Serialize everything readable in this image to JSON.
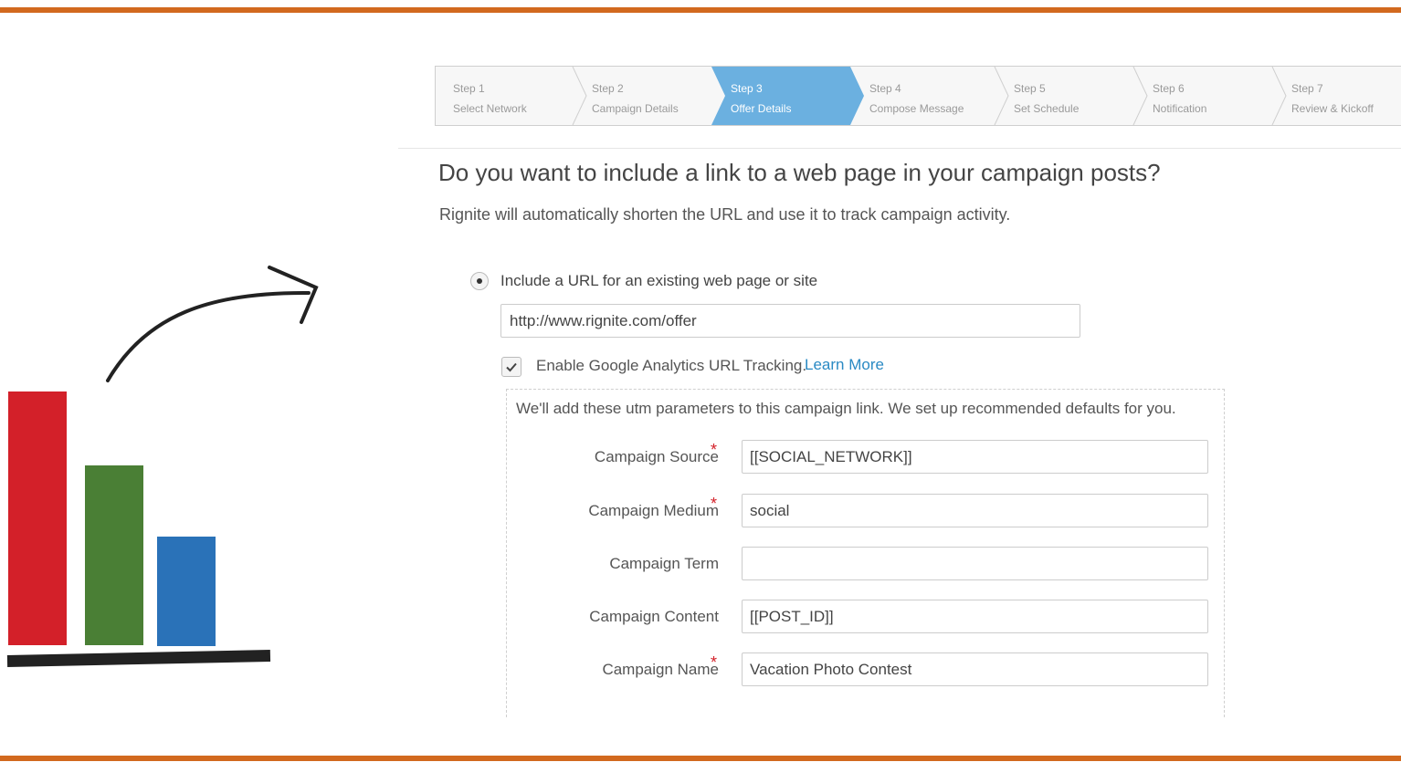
{
  "colors": {
    "accent_rule": "#d2691e",
    "active_step": "#6bb0e0",
    "link": "#2a8ac4",
    "required": "#d32029",
    "bar_red": "#d32029",
    "bar_green": "#4a7f35",
    "bar_blue": "#2a72b8"
  },
  "wizard": {
    "steps": [
      {
        "num": "Step 1",
        "label": "Select Network",
        "active": false
      },
      {
        "num": "Step 2",
        "label": "Campaign Details",
        "active": false
      },
      {
        "num": "Step 3",
        "label": "Offer Details",
        "active": true
      },
      {
        "num": "Step 4",
        "label": "Compose Message",
        "active": false
      },
      {
        "num": "Step 5",
        "label": "Set Schedule",
        "active": false
      },
      {
        "num": "Step 6",
        "label": "Notification",
        "active": false
      },
      {
        "num": "Step 7",
        "label": "Review & Kickoff",
        "active": false
      }
    ]
  },
  "main": {
    "question": "Do you want to include a link to a web page in your campaign posts?",
    "subtext": "Rignite will automatically shorten the URL and use it to track campaign activity.",
    "url_option": {
      "label": "Include a URL for an existing web page or site",
      "selected": true,
      "value": "http://www.rignite.com/offer"
    },
    "analytics": {
      "label": "Enable Google Analytics URL Tracking.",
      "checked": true,
      "learn_more": "Learn More"
    },
    "utm": {
      "note": "We'll add these utm parameters to this campaign link. We set up recommended defaults for you.",
      "fields": [
        {
          "label": "Campaign Source",
          "required": true,
          "value": "[[SOCIAL_NETWORK]]"
        },
        {
          "label": "Campaign Medium",
          "required": true,
          "value": "social"
        },
        {
          "label": "Campaign Term",
          "required": false,
          "value": ""
        },
        {
          "label": "Campaign Content",
          "required": false,
          "value": "[[POST_ID]]"
        },
        {
          "label": "Campaign Name",
          "required": true,
          "value": "Vacation Photo Contest"
        }
      ],
      "required_mark": "*"
    }
  },
  "illustration": {
    "icons": [
      "bar-chart-icon",
      "curved-arrow-icon"
    ]
  }
}
